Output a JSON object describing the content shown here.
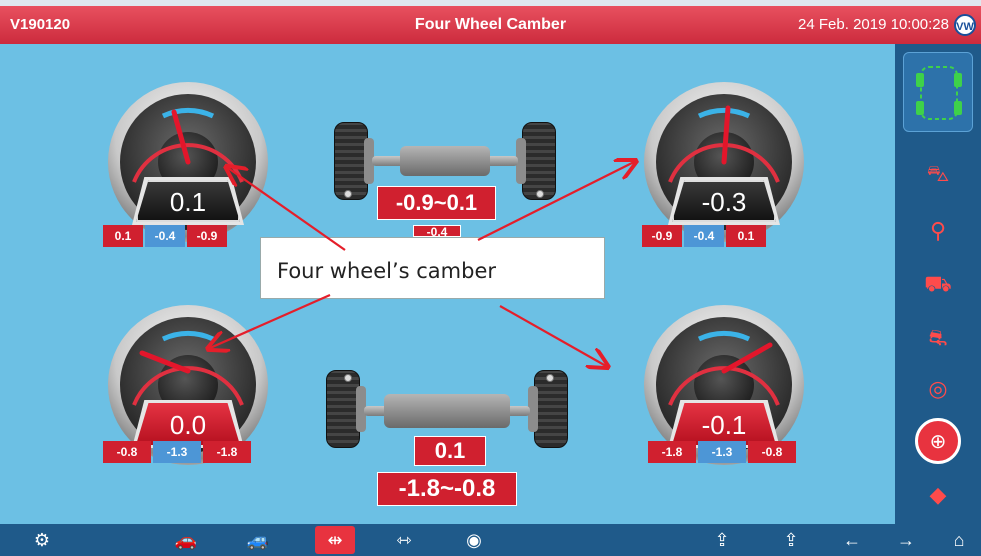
{
  "header": {
    "code": "V190120",
    "title": "Four Wheel Camber",
    "datetime": "24 Feb. 2019 10:00:28",
    "logo_text": "VW"
  },
  "gauges": {
    "front_left": {
      "value": "0.1",
      "min": "0.1",
      "mid": "-0.4",
      "max": "-0.9",
      "readout": "dark"
    },
    "front_right": {
      "value": "-0.3",
      "min": "-0.9",
      "mid": "-0.4",
      "max": "0.1",
      "readout": "dark"
    },
    "rear_left": {
      "value": "0.0",
      "min": "-0.8",
      "mid": "-1.3",
      "max": "-1.8",
      "readout": "red"
    },
    "rear_right": {
      "value": "-0.1",
      "min": "-1.8",
      "mid": "-1.3",
      "max": "-0.8",
      "readout": "red"
    }
  },
  "front_axle": {
    "range": "-0.9~0.1",
    "center": "-0.4"
  },
  "rear_axle": {
    "center": "0.1",
    "range": "-1.8~-0.8"
  },
  "callout": {
    "text": "Four wheel’s camber"
  },
  "sidebar": {
    "items": [
      {
        "name": "car-overview-icon"
      },
      {
        "name": "car-lift-icon"
      },
      {
        "name": "car-search-icon"
      },
      {
        "name": "car-service-icon"
      },
      {
        "name": "car-front-icon"
      },
      {
        "name": "wheel-adjust-icon"
      },
      {
        "name": "axle-active-icon"
      },
      {
        "name": "eraser-icon"
      }
    ]
  },
  "colors": {
    "accent_red": "#d0202f",
    "value_blue": "#4d96d6",
    "panel_blue": "#1f5a8a",
    "bg": "#6cc0e4"
  },
  "bottom_bar": {
    "buttons": [
      "settings-icon",
      "car-side-icon",
      "car-side-alt-icon",
      "toe-icon",
      "axle-icon",
      "steering-icon",
      "lift-up-icon",
      "lift-up-alt-icon",
      "arrow-left-icon",
      "arrow-right-icon",
      "home-icon"
    ]
  }
}
